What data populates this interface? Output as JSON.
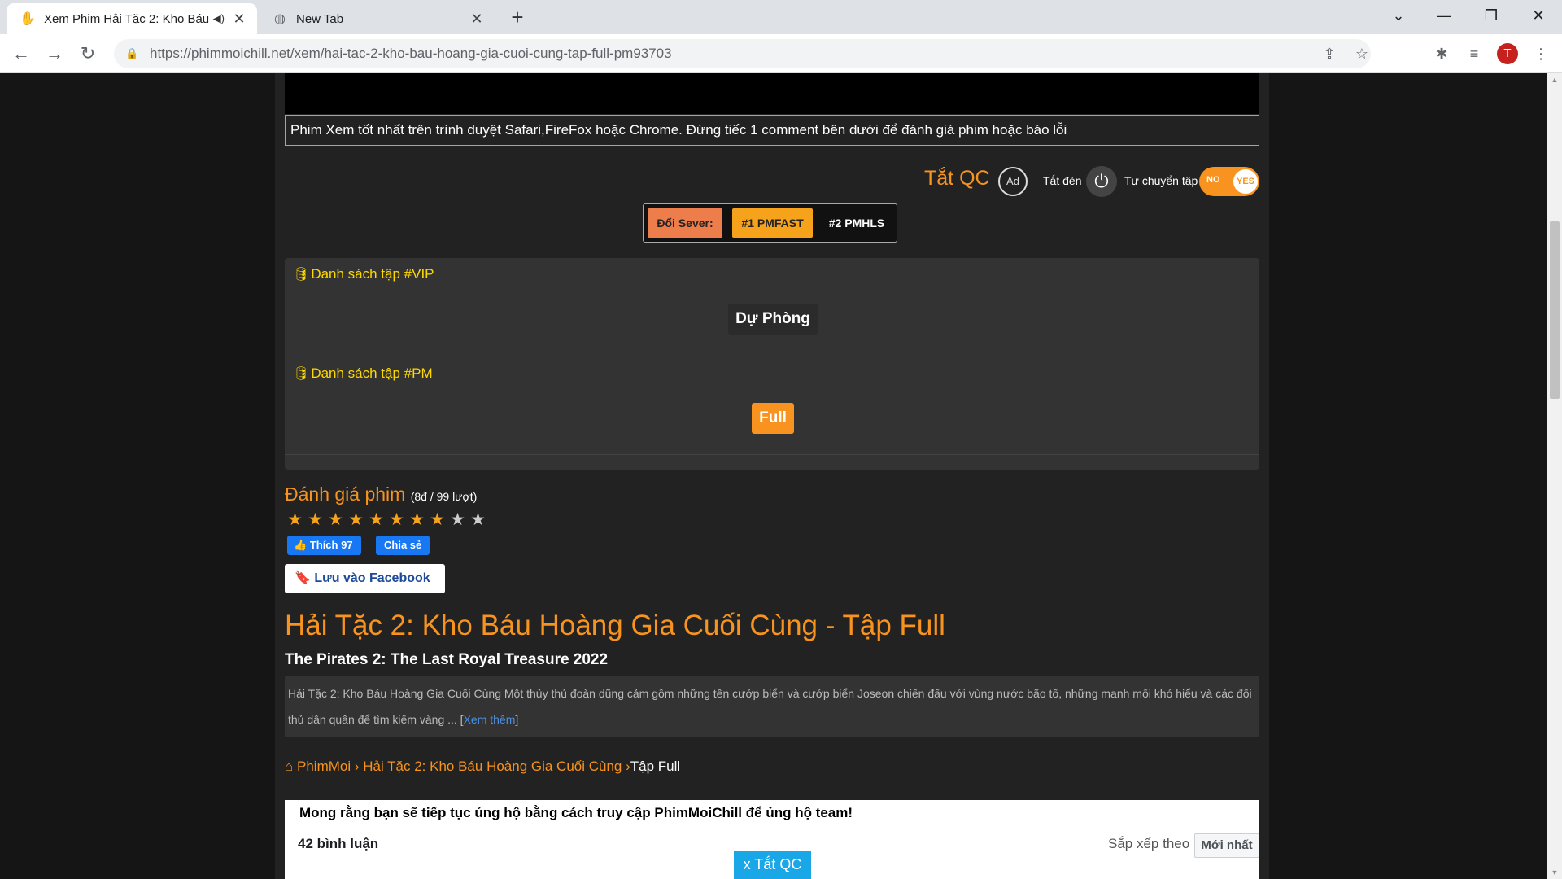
{
  "browser": {
    "tabs": [
      {
        "title": "Xem Phim Hải Tặc 2: Kho Báu",
        "favicon": "✋"
      },
      {
        "title": "New Tab",
        "favicon": "◍"
      }
    ],
    "url": "https://phimmoichill.net/xem/hai-tac-2-kho-bau-hoang-gia-cuoi-cung-tap-full-pm93703",
    "profile_initial": "T"
  },
  "player": {
    "notice": "Phim Xem tốt nhất trên trình duyệt Safari,FireFox hoặc Chrome. Đừng tiếc 1 comment bên dưới để đánh giá phim hoặc báo lỗi"
  },
  "controls": {
    "tat_qc": "Tắt QC",
    "no_ad_icon": "Ad",
    "tat_den": "Tắt đèn",
    "auto_next": "Tự chuyển tập",
    "toggle_no": "NO",
    "toggle_yes": "YES"
  },
  "servers": {
    "label": "Đổi Sever:",
    "items": [
      "#1 PMFAST",
      "#2 PMHLS"
    ],
    "active_index": 0
  },
  "episodes": {
    "vip_title": "Danh sách tập #VIP",
    "vip_button": "Dự Phòng",
    "pm_title": "Danh sách tập #PM",
    "pm_button": "Full"
  },
  "rating": {
    "title": "Đánh giá phim",
    "summary": "(8đ / 99 lượt)",
    "score": 8,
    "max": 10
  },
  "social": {
    "like": "Thích 97",
    "share": "Chia sẻ",
    "save": "Lưu vào Facebook"
  },
  "movie": {
    "title": "Hải Tặc 2: Kho Báu Hoàng Gia Cuối Cùng - Tập Full",
    "subtitle": "The Pirates 2: The Last Royal Treasure 2022",
    "description": "Hải Tặc 2: Kho Báu Hoàng Gia Cuối Cùng Một thủy thủ đoàn dũng cảm gồm những tên cướp biển và cướp biển Joseon chiến đấu với vùng nước bão tố, những manh mối khó hiểu và các đối thủ dân quân để tìm kiếm vàng ... [",
    "more": "Xem thêm",
    "more_close": "]"
  },
  "breadcrumb": {
    "home": "PhimMoi",
    "sep1": " › ",
    "movie": "Hải Tặc 2: Kho Báu Hoàng Gia Cuối Cùng",
    "sep2": " ›",
    "current": "Tập Full"
  },
  "comments": {
    "message": "Mong rằng bạn sẽ tiếp tục ủng hộ bằng cách truy cập PhimMoiChill để ủng hộ team!",
    "count": "42 bình luận",
    "sort_label": "Sắp xếp theo",
    "sort_value": "Mới nhất",
    "close_ad": "x Tắt QC"
  }
}
